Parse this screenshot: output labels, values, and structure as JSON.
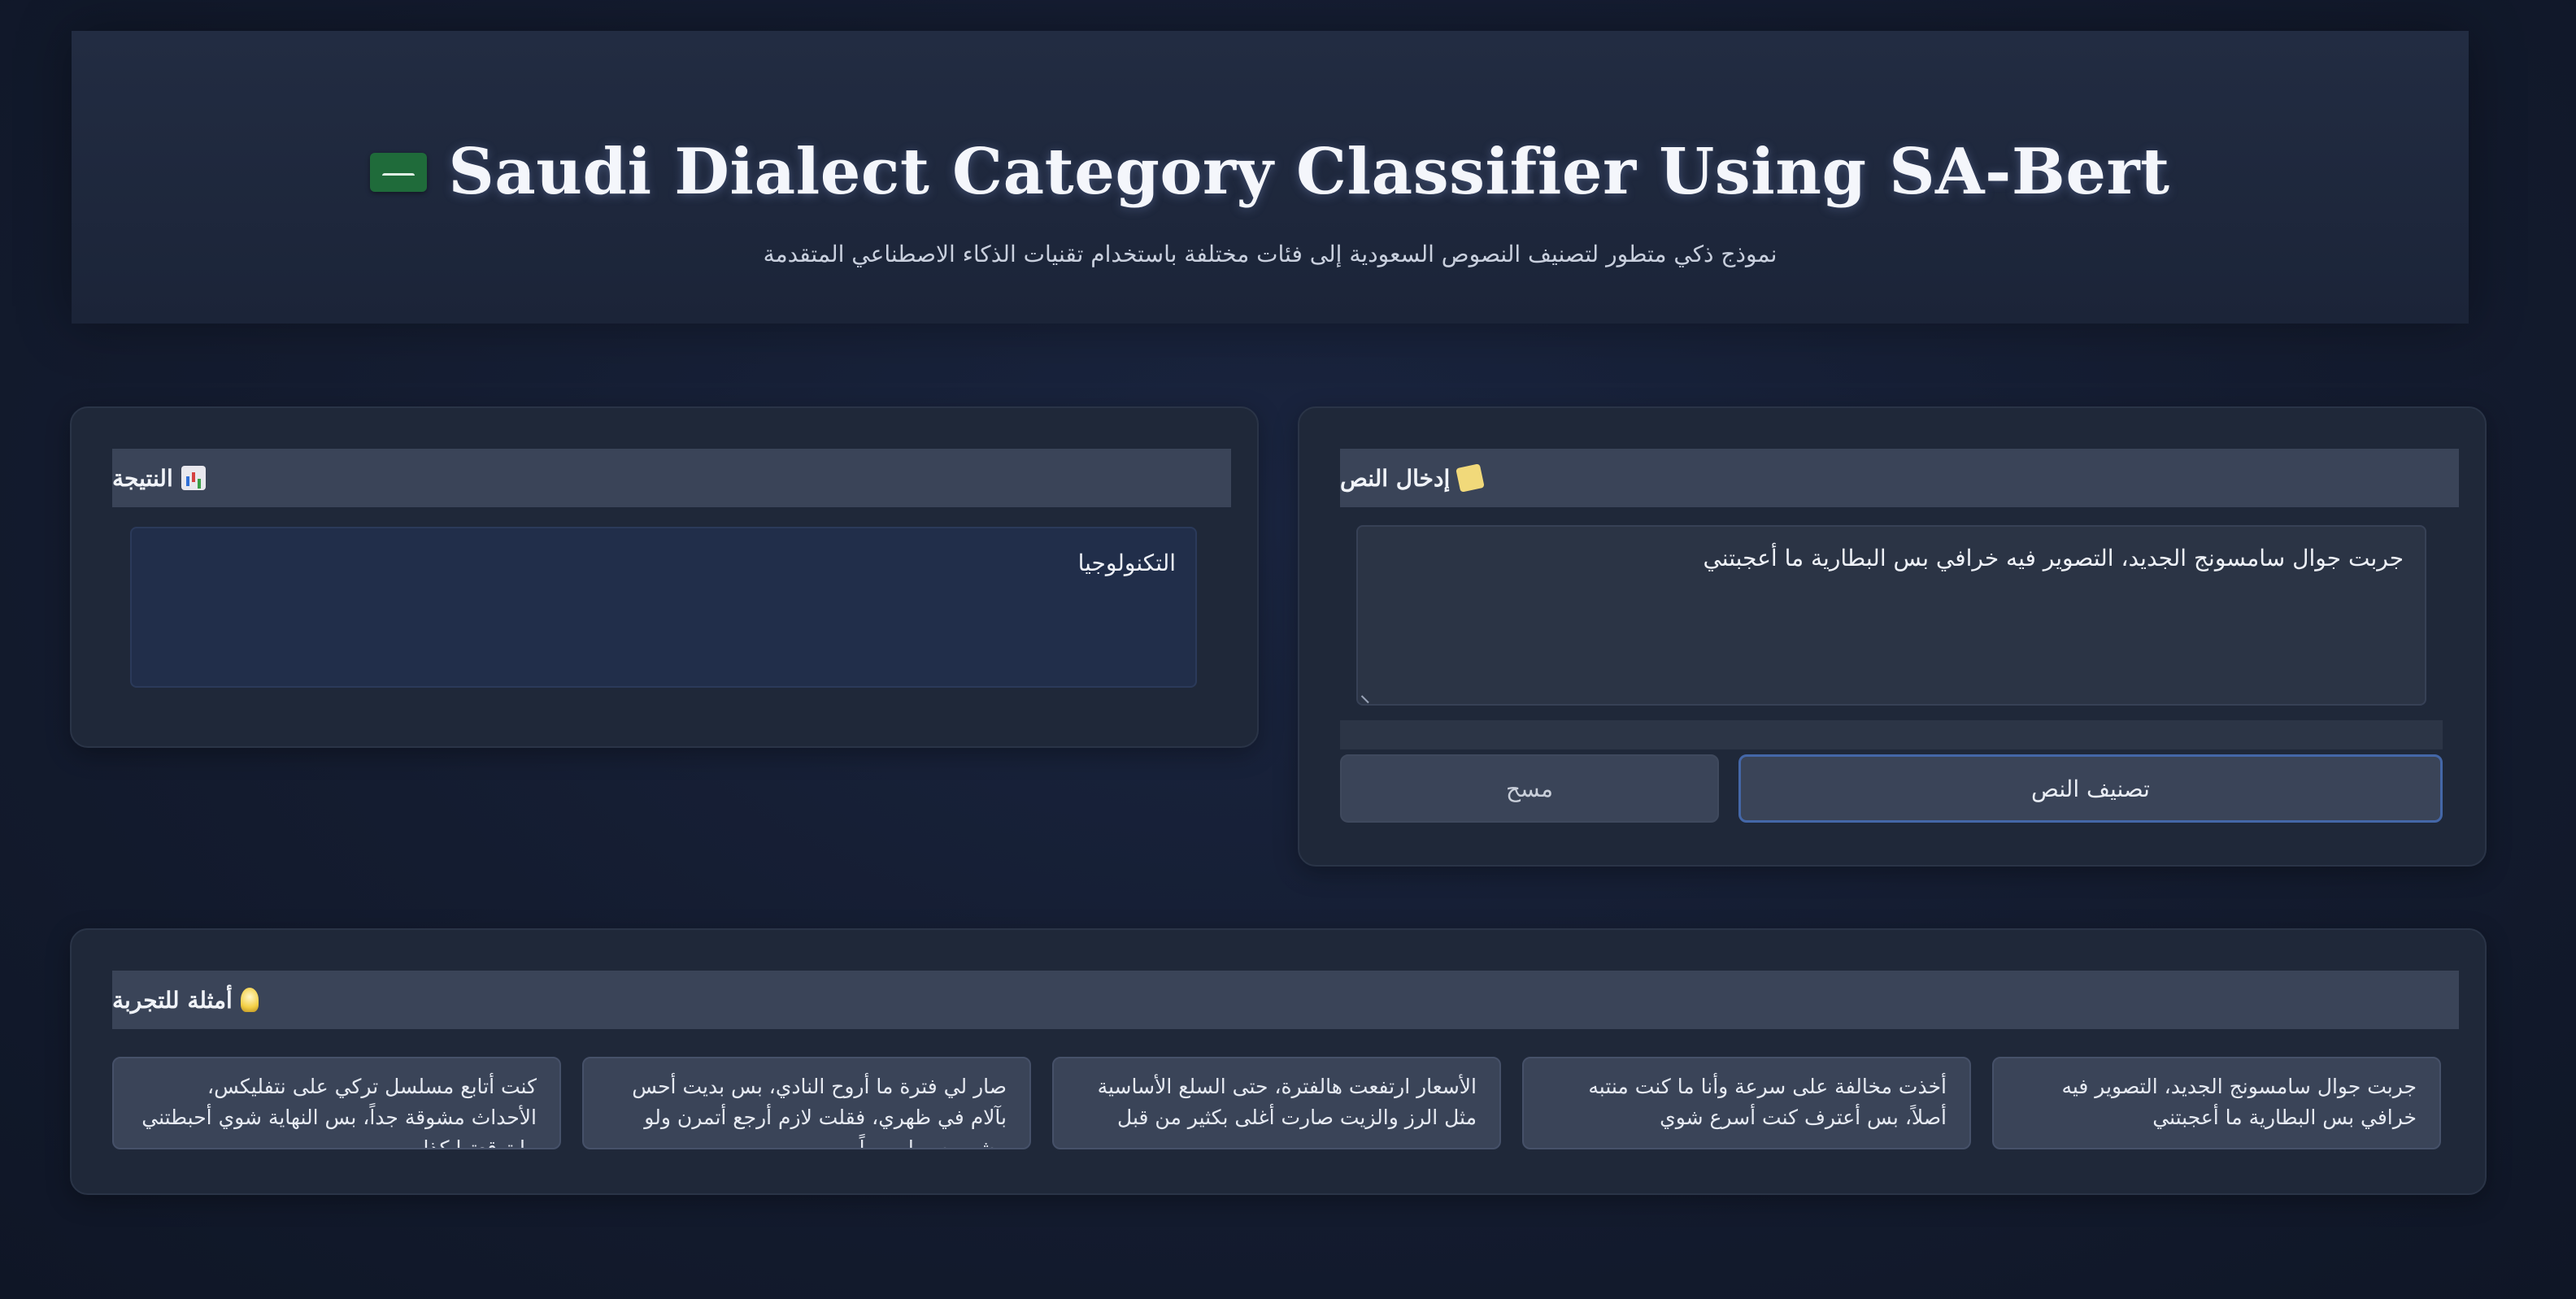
{
  "header": {
    "flag_icon": "saudi-flag-icon",
    "title": "Saudi Dialect Category Classifier Using SA-Bert",
    "subtitle": "نموذج ذكي متطور لتصنيف النصوص السعودية إلى فئات مختلفة باستخدام تقنيات الذكاء الاصطناعي المتقدمة"
  },
  "result_panel": {
    "icon": "bar-chart-icon",
    "title": "النتيجة",
    "value": "التكنولوجيا"
  },
  "input_panel": {
    "icon": "memo-pencil-icon",
    "title": "إدخال النص",
    "value": "جربت جوال سامسونج الجديد، التصوير فيه خرافي بس البطارية ما أعجبتني",
    "classify_label": "تصنيف النص",
    "clear_label": "مسح"
  },
  "examples": {
    "icon": "light-bulb-icon",
    "title": "أمثلة للتجربة",
    "items": [
      "جربت جوال سامسونج الجديد، التصوير فيه خرافي بس البطارية ما أعجبتني",
      "أخذت مخالفة على سرعة وأنا ما كنت منتبه أصلاً، بس أعترف كنت أسرع شوي",
      "الأسعار ارتفعت هالفترة، حتى السلع الأساسية مثل الرز والزيت صارت أغلى بكثير من قبل",
      "صار لي فترة ما أروح النادي، بس بديت أحس بآلام في ظهري، فقلت لازم أرجع أتمرن ولو مشي بسيط يومياً",
      "كنت أتابع مسلسل تركي على نتفليكس، الأحداث مشوقة جداً، بس النهاية شوي أحبطتني ما توقعتها كذا"
    ]
  }
}
